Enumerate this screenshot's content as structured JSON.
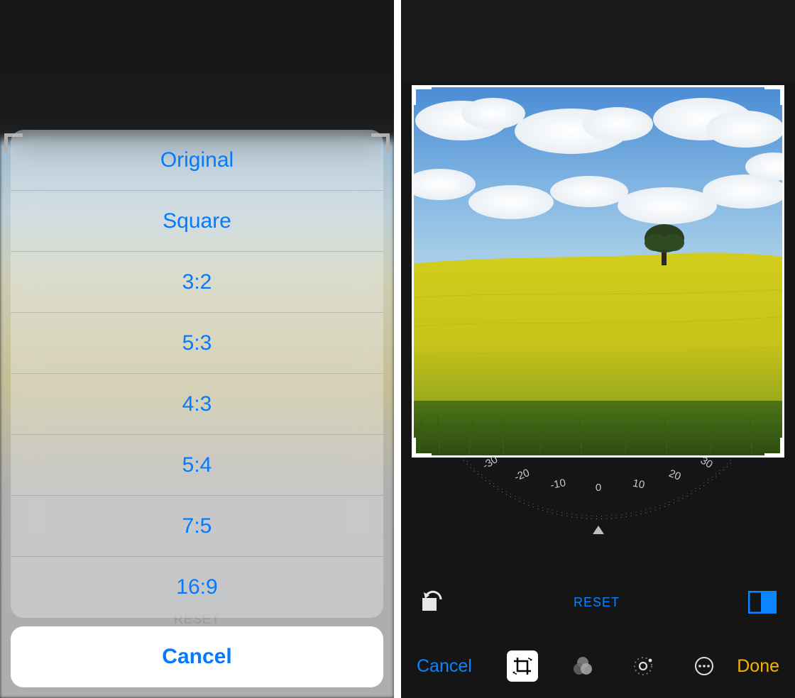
{
  "action_sheet": {
    "options": [
      "Original",
      "Square",
      "3:2",
      "5:3",
      "4:3",
      "5:4",
      "7:5",
      "16:9"
    ],
    "cancel_label": "Cancel",
    "reset_hint": "RESET"
  },
  "editor": {
    "angle_ticks": [
      "-30",
      "-20",
      "-10",
      "0",
      "10",
      "20",
      "30"
    ],
    "current_angle": 0,
    "reset_label": "RESET",
    "cancel_label": "Cancel",
    "done_label": "Done",
    "tools": {
      "crop": "crop-icon",
      "filters": "filters-icon",
      "adjust": "adjust-icon",
      "more": "more-icon"
    },
    "active_tool": "crop"
  },
  "colors": {
    "ios_blue": "#0b84ff",
    "ios_yellow": "#f4b400"
  }
}
